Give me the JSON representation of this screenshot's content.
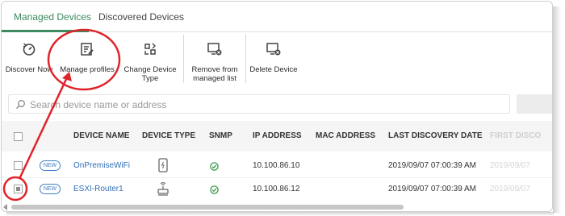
{
  "tabs": [
    {
      "label": "Managed Devices",
      "active": true
    },
    {
      "label": "Discovered Devices",
      "active": false
    }
  ],
  "toolbar": {
    "discover_now": "Discover Now",
    "manage_profiles": "Manage profiles",
    "change_device_type_1": "Change Device",
    "change_device_type_2": "Type",
    "remove_managed_1": "Remove from",
    "remove_managed_2": "managed list",
    "delete_device": "Delete Device"
  },
  "search": {
    "placeholder": "Search device name or address",
    "value": ""
  },
  "table": {
    "headers": {
      "device_name": "DEVICE NAME",
      "device_type": "DEVICE TYPE",
      "snmp": "SNMP",
      "ip_address": "IP ADDRESS",
      "mac_address": "MAC ADDRESS",
      "last_discovery": "LAST DISCOVERY DATE",
      "first_discovery": "FIRST DISCO"
    },
    "rows": [
      {
        "badge": "NEW",
        "name": "OnPremiseWiFi",
        "device_type_icon": "tablet-icon",
        "snmp_icon": "check-circle-icon",
        "ip": "10.100.86.10",
        "mac": "",
        "last": "2019/09/07 07:00:39 AM",
        "first": "2019/09/07",
        "checked": false
      },
      {
        "badge": "NEW",
        "name": "ESXI-Router1",
        "device_type_icon": "router-icon",
        "snmp_icon": "check-circle-icon",
        "ip": "10.100.86.12",
        "mac": "",
        "last": "2019/09/07 07:00:39 AM",
        "first": "2019/09/07",
        "checked": true
      }
    ]
  },
  "colors": {
    "accent": "#3c8a5d",
    "link": "#2f6fb6",
    "annotation": "#e0232a",
    "snmp_ok": "#3a9a4a"
  }
}
